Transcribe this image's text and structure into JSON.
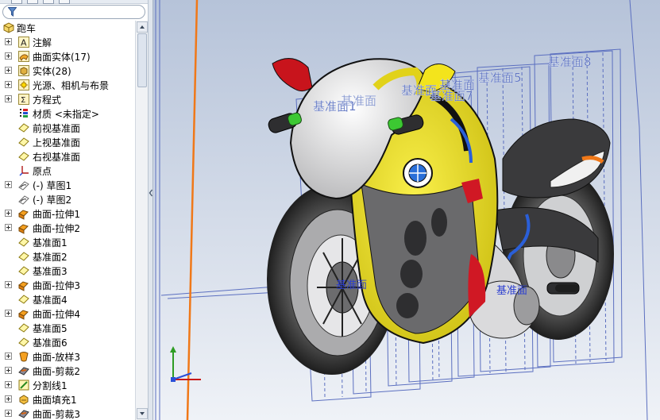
{
  "feature_tree": {
    "root": {
      "label": "跑车",
      "icon": "part-icon"
    },
    "items": [
      {
        "label": "注解",
        "icon": "annotation-icon",
        "expand": true
      },
      {
        "label": "曲面实体(17)",
        "icon": "surface-bodies-icon",
        "expand": true
      },
      {
        "label": "实体(28)",
        "icon": "solid-bodies-icon",
        "expand": true
      },
      {
        "label": "光源、相机与布景",
        "icon": "lights-camera-icon",
        "expand": true
      },
      {
        "label": "方程式",
        "icon": "equations-icon",
        "expand": true
      },
      {
        "label": "材质 <未指定>",
        "icon": "material-icon",
        "expand": false
      },
      {
        "label": "前视基准面",
        "icon": "plane-icon",
        "expand": false
      },
      {
        "label": "上视基准面",
        "icon": "plane-icon",
        "expand": false
      },
      {
        "label": "右视基准面",
        "icon": "plane-icon",
        "expand": false
      },
      {
        "label": "原点",
        "icon": "origin-icon",
        "expand": false
      },
      {
        "label": "(-) 草图1",
        "icon": "sketch-icon",
        "expand": true
      },
      {
        "label": "(-) 草图2",
        "icon": "sketch-icon",
        "expand": false
      },
      {
        "label": "曲面-拉伸1",
        "icon": "surface-extrude-icon",
        "expand": true
      },
      {
        "label": "曲面-拉伸2",
        "icon": "surface-extrude-icon",
        "expand": true
      },
      {
        "label": "基准面1",
        "icon": "plane-icon",
        "expand": false
      },
      {
        "label": "基准面2",
        "icon": "plane-icon",
        "expand": false
      },
      {
        "label": "基准面3",
        "icon": "plane-icon",
        "expand": false
      },
      {
        "label": "曲面-拉伸3",
        "icon": "surface-extrude-icon",
        "expand": true
      },
      {
        "label": "基准面4",
        "icon": "plane-icon",
        "expand": false
      },
      {
        "label": "曲面-拉伸4",
        "icon": "surface-extrude-icon",
        "expand": true
      },
      {
        "label": "基准面5",
        "icon": "plane-icon",
        "expand": false
      },
      {
        "label": "基准面6",
        "icon": "plane-icon",
        "expand": false
      },
      {
        "label": "曲面-放样3",
        "icon": "surface-loft-icon",
        "expand": true
      },
      {
        "label": "曲面-剪裁2",
        "icon": "surface-trim-icon",
        "expand": true
      },
      {
        "label": "分割线1",
        "icon": "split-line-icon",
        "expand": true
      },
      {
        "label": "曲面填充1",
        "icon": "surface-fill-icon",
        "expand": true
      },
      {
        "label": "曲面-剪裁3",
        "icon": "surface-trim-icon",
        "expand": true
      }
    ]
  },
  "viewport": {
    "plane_labels": [
      "基准面1",
      "基准面",
      "基准面",
      "基准面7",
      "基准面",
      "基准面5",
      "基准面8"
    ],
    "origin_labels": [
      "基准面",
      "基准面"
    ]
  },
  "colors": {
    "body_yellow": "#f3e41c",
    "fairing_white": "#e2e2e2",
    "mirror_red": "#c8141c",
    "grip_green": "#3cc832",
    "plane_blue": "#5b6fc0",
    "axis_orange": "#f07818",
    "viewport_bg_top": "#b6c3d9",
    "viewport_bg_bottom": "#eff2f7"
  }
}
